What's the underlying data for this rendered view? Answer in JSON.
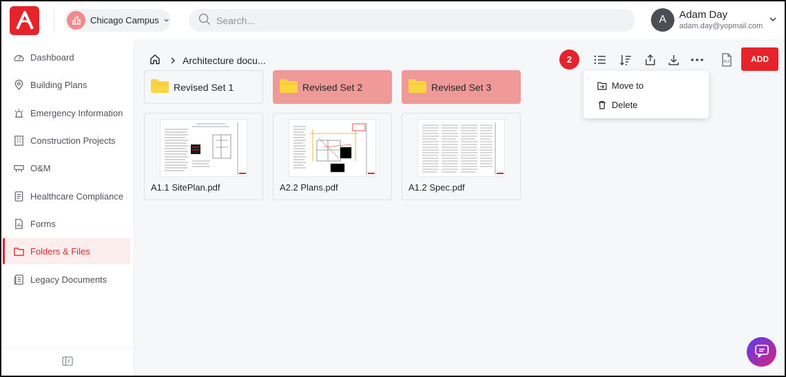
{
  "header": {
    "campus_label": "Chicago Campus",
    "search_placeholder": "Search...",
    "user_initial": "A",
    "user_name": "Adam Day",
    "user_email": "adam.day@yopmail.com"
  },
  "sidebar": {
    "items": [
      {
        "label": "Dashboard",
        "icon": "gauge-icon"
      },
      {
        "label": "Building Plans",
        "icon": "map-pin-icon"
      },
      {
        "label": "Emergency Information",
        "icon": "alarm-icon"
      },
      {
        "label": "Construction Projects",
        "icon": "building-icon"
      },
      {
        "label": "O&M",
        "icon": "tools-icon"
      },
      {
        "label": "Healthcare Compliance",
        "icon": "clipboard-icon"
      },
      {
        "label": "Forms",
        "icon": "form-icon"
      },
      {
        "label": "Folders & Files",
        "icon": "folder-icon",
        "active": true
      },
      {
        "label": "Legacy Documents",
        "icon": "documents-icon"
      }
    ]
  },
  "main": {
    "breadcrumb_current": "Architecture docu...",
    "selected_count": "2",
    "add_label": "ADD",
    "folders": [
      {
        "label": "Revised Set 1",
        "selected": false
      },
      {
        "label": "Revised Set 2",
        "selected": true
      },
      {
        "label": "Revised Set 3",
        "selected": true
      }
    ],
    "files": [
      {
        "name": "A1.1 SitePlan.pdf"
      },
      {
        "name": "A2.2 Plans.pdf"
      },
      {
        "name": "A1.2 Spec.pdf"
      }
    ],
    "menu": {
      "move_label": "Move to",
      "delete_label": "Delete"
    }
  },
  "colors": {
    "brand": "#e5232b",
    "selected_folder": "#ef9a98",
    "active_nav_bg": "#fdeeee"
  }
}
